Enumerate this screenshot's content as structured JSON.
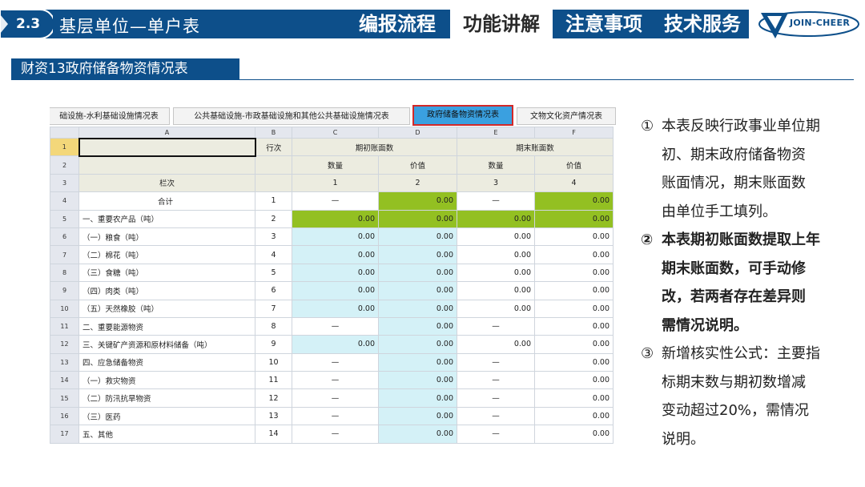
{
  "header": {
    "section_number": "2.3",
    "page_title": "基层单位—单户表",
    "nav_tabs": [
      {
        "label": "编报流程",
        "active": false
      },
      {
        "label": "功能讲解",
        "active": true
      },
      {
        "label": "注意事项",
        "active": false
      },
      {
        "label": "技术服务",
        "active": false
      }
    ],
    "logo_text": "JOIN-CHEER",
    "subtitle": "财资13政府储备物资情况表",
    "accent_color": "#0d4f8a"
  },
  "sheet": {
    "tabs": [
      {
        "label": "础设施-水利基础设施情况表",
        "active": false
      },
      {
        "label": "公共基础设施-市政基础设施和其他公共基础设施情况表",
        "active": false
      },
      {
        "label": "政府储备物资情况表",
        "active": true
      },
      {
        "label": "文物文化资产情况表",
        "active": false
      }
    ],
    "column_letters": [
      "A",
      "B",
      "C",
      "D",
      "E",
      "F"
    ],
    "header_rows": {
      "row1": {
        "b": "行次",
        "opening": "期初账面数",
        "closing": "期末账面数"
      },
      "row2": {
        "qty": "数量",
        "val": "价值"
      },
      "row3": {
        "a": "栏次",
        "c": "1",
        "d": "2",
        "e": "3",
        "f": "4"
      }
    },
    "rows": [
      {
        "rn": "4",
        "a": "合计",
        "b": "1",
        "c": "—",
        "d": "0.00",
        "e": "—",
        "f": "0.00"
      },
      {
        "rn": "5",
        "a": "一、重要农产品（吨）",
        "b": "2",
        "c": "0.00",
        "d": "0.00",
        "e": "0.00",
        "f": "0.00"
      },
      {
        "rn": "6",
        "a": "（一）粮食（吨）",
        "b": "3",
        "c": "0.00",
        "d": "0.00",
        "e": "0.00",
        "f": "0.00"
      },
      {
        "rn": "7",
        "a": "（二）棉花（吨）",
        "b": "4",
        "c": "0.00",
        "d": "0.00",
        "e": "0.00",
        "f": "0.00"
      },
      {
        "rn": "8",
        "a": "（三）食糖（吨）",
        "b": "5",
        "c": "0.00",
        "d": "0.00",
        "e": "0.00",
        "f": "0.00"
      },
      {
        "rn": "9",
        "a": "（四）肉类（吨）",
        "b": "6",
        "c": "0.00",
        "d": "0.00",
        "e": "0.00",
        "f": "0.00"
      },
      {
        "rn": "10",
        "a": "（五）天然橡胶（吨）",
        "b": "7",
        "c": "0.00",
        "d": "0.00",
        "e": "0.00",
        "f": "0.00"
      },
      {
        "rn": "11",
        "a": "二、重要能源物资",
        "b": "8",
        "c": "—",
        "d": "0.00",
        "e": "—",
        "f": "0.00"
      },
      {
        "rn": "12",
        "a": "三、关键矿产资源和原材料储备（吨）",
        "b": "9",
        "c": "0.00",
        "d": "0.00",
        "e": "0.00",
        "f": "0.00"
      },
      {
        "rn": "13",
        "a": "四、应急储备物资",
        "b": "10",
        "c": "—",
        "d": "0.00",
        "e": "—",
        "f": "0.00"
      },
      {
        "rn": "14",
        "a": "（一）救灾物资",
        "b": "11",
        "c": "—",
        "d": "0.00",
        "e": "—",
        "f": "0.00"
      },
      {
        "rn": "15",
        "a": "（二）防汛抗旱物资",
        "b": "12",
        "c": "—",
        "d": "0.00",
        "e": "—",
        "f": "0.00"
      },
      {
        "rn": "16",
        "a": "（三）医药",
        "b": "13",
        "c": "—",
        "d": "0.00",
        "e": "—",
        "f": "0.00"
      },
      {
        "rn": "17",
        "a": "五、其他",
        "b": "14",
        "c": "—",
        "d": "0.00",
        "e": "—",
        "f": "0.00"
      }
    ],
    "colors": {
      "cyan": "#d4f1f7",
      "green": "#93c022",
      "header": "#ecece0"
    }
  },
  "notes": [
    {
      "mark": "①",
      "text": "本表反映行政事业单位期初、期末政府储备物资账面情况，期末账面数由单位手工填列。",
      "lines": [
        "本表反映行政事业单位期",
        "初、期末政府储备物资",
        "账面情况，期末账面数",
        "由单位手工填列。"
      ],
      "bold": false
    },
    {
      "mark": "②",
      "lines": [
        "本表期初账面数提取上年",
        "期末账面数，可手动修",
        "改，若两者存在差异则",
        "需情况说明。"
      ],
      "bold": true
    },
    {
      "mark": "③",
      "lines": [
        "新增核实性公式：主要指",
        "标期末数与期初数增减",
        "变动超过20%，需情况",
        "说明。"
      ],
      "bold": false
    }
  ]
}
